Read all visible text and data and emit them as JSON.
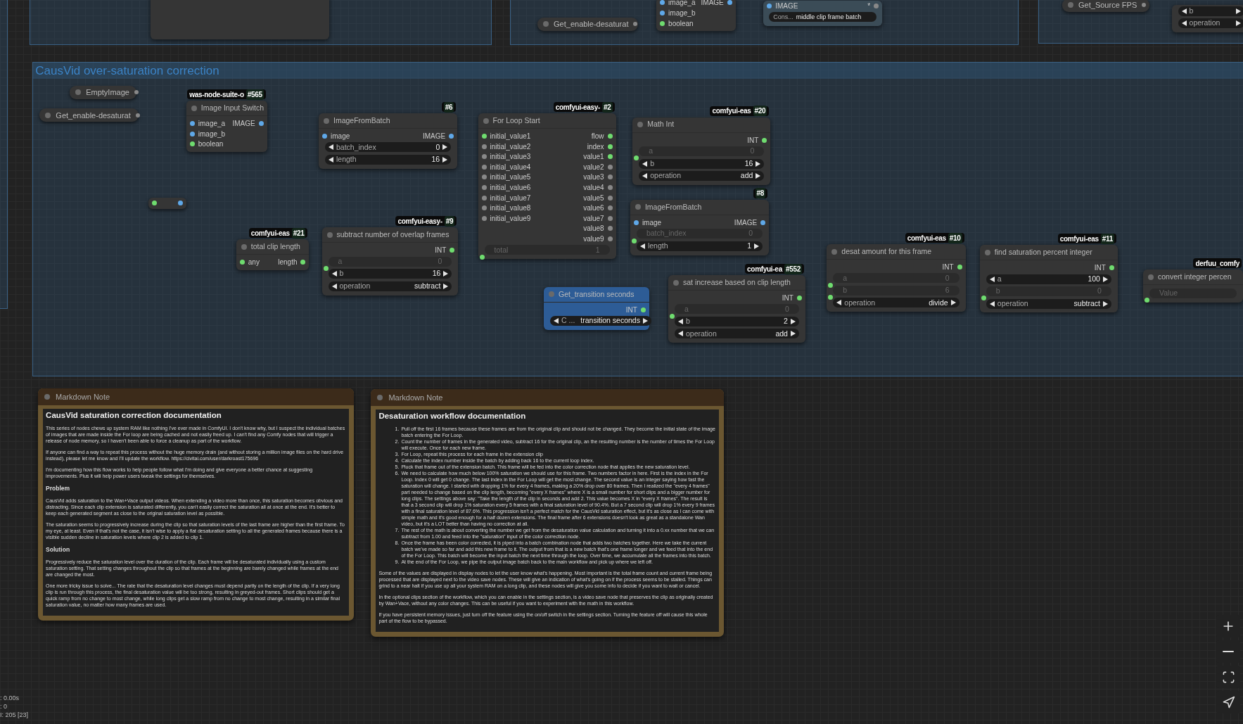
{
  "groups": [
    {
      "kind": "group"
    },
    {
      "kind": "group",
      "nodes": [
        {
          "kind": "node"
        }
      ]
    },
    {
      "kind": "group",
      "nodes": [
        {
          "kind": "pill",
          "title": "Get_enable-desaturat"
        },
        {
          "kind": "node",
          "inputs": [
            {
              "label": "image_a",
              "color": "#5fa8e8"
            },
            {
              "label": "image_b",
              "color": "#5fa8e8"
            },
            {
              "label": "boolean",
              "color": "#6fdc6f"
            }
          ],
          "outputs": [
            {
              "label": "IMAGE",
              "color": "#5fa8e8"
            }
          ]
        },
        {
          "kind": "node",
          "color": "#3b4c57",
          "inputs": [
            {
              "label": "IMAGE",
              "color": "#5fa8e8"
            }
          ],
          "outputs": [
            {
              "label": "*",
              "color": "#888888"
            }
          ],
          "widgets": [
            {
              "kind": "text",
              "label": "Cons...",
              "value": "middle clip frame batch",
              "linked": false
            }
          ]
        }
      ]
    },
    {
      "kind": "group",
      "nodes": [
        {
          "kind": "pill",
          "title": "Get_Source FPS"
        },
        {
          "kind": "node",
          "widgets": [
            {
              "label": "b",
              "linked": false
            },
            {
              "label": "operation",
              "linked": false
            }
          ]
        }
      ]
    },
    {
      "kind": "group",
      "title": "CausVid over-saturation correction",
      "nodes": [
        {
          "kind": "pill",
          "title": "EmptyImage"
        },
        {
          "kind": "pill",
          "title": "Get_enable-desaturat"
        },
        {
          "kind": "node",
          "badge": {
            "source": "was-node-suite-o",
            "id": "#565"
          },
          "title": "Image Input Switch",
          "inputs": [
            {
              "label": "image_a",
              "color": "#5fa8e8"
            },
            {
              "label": "image_b",
              "color": "#5fa8e8"
            },
            {
              "label": "boolean",
              "color": "#6fdc6f"
            }
          ],
          "outputs": [
            {
              "label": "IMAGE",
              "color": "#5fa8e8"
            }
          ]
        },
        {
          "kind": "reroute",
          "inputs": [
            {
              "color": "#6fdc6f"
            }
          ],
          "outputs": [
            {
              "color": "#5fa8e8"
            }
          ]
        },
        {
          "kind": "node",
          "badge": {
            "id": "#6"
          },
          "title": "ImageFromBatch",
          "inputs": [
            {
              "label": "image",
              "color": "#5fa8e8"
            }
          ],
          "outputs": [
            {
              "label": "IMAGE",
              "color": "#5fa8e8"
            }
          ],
          "widgets": [
            {
              "label": "batch_index",
              "value": "0",
              "linked": false
            },
            {
              "label": "length",
              "value": "16",
              "linked": false
            }
          ]
        },
        {
          "kind": "node",
          "badge": {
            "source": "comfyui-easy-",
            "id": "#2"
          },
          "title": "For Loop Start",
          "inputs": [
            {
              "label": "initial_value1",
              "color": "#6fdc6f"
            },
            {
              "label": "initial_value2",
              "color": "#888888"
            },
            {
              "label": "initial_value3",
              "color": "#888888"
            },
            {
              "label": "initial_value4",
              "color": "#888888"
            },
            {
              "label": "initial_value5",
              "color": "#888888"
            },
            {
              "label": "initial_value6",
              "color": "#888888"
            },
            {
              "label": "initial_value7",
              "color": "#888888"
            },
            {
              "label": "initial_value8",
              "color": "#888888"
            },
            {
              "label": "initial_value9",
              "color": "#888888"
            }
          ],
          "outputs": [
            {
              "label": "flow",
              "color": "#6fdc6f"
            },
            {
              "label": "index",
              "color": "#6fdc6f"
            },
            {
              "label": "value1",
              "color": "#6fdc6f"
            },
            {
              "label": "value2",
              "color": "#888888"
            },
            {
              "label": "value3",
              "color": "#888888"
            },
            {
              "label": "value4",
              "color": "#888888"
            },
            {
              "label": "value5",
              "color": "#888888"
            },
            {
              "label": "value6",
              "color": "#888888"
            },
            {
              "label": "value7",
              "color": "#888888"
            },
            {
              "label": "value8",
              "color": "#888888"
            },
            {
              "label": "value9",
              "color": "#888888"
            }
          ],
          "widgets": [
            {
              "label": "total",
              "value": "1",
              "linked": true
            }
          ]
        },
        {
          "kind": "node",
          "badge": {
            "source": "comfyui-eas",
            "id": "#20"
          },
          "title": "Math Int",
          "outputs": [
            {
              "label": "INT",
              "color": "#6fdc6f"
            }
          ],
          "widgets": [
            {
              "label": "a",
              "value": "0",
              "linked": true
            },
            {
              "label": "b",
              "value": "16",
              "linked": false
            },
            {
              "label": "operation",
              "value": "add",
              "linked": false
            }
          ]
        },
        {
          "kind": "node",
          "badge": {
            "id": "#8"
          },
          "title": "ImageFromBatch",
          "inputs": [
            {
              "label": "image",
              "color": "#5fa8e8"
            }
          ],
          "outputs": [
            {
              "label": "IMAGE",
              "color": "#5fa8e8"
            }
          ],
          "widgets": [
            {
              "label": "batch_index",
              "value": "0",
              "linked": true
            },
            {
              "label": "length",
              "value": "1",
              "linked": false
            }
          ]
        },
        {
          "kind": "node",
          "badge": {
            "source": "comfyui-eas",
            "id": "#21"
          },
          "title": "total clip length",
          "inputs": [
            {
              "label": "any",
              "color": "#6fdc6f"
            }
          ],
          "outputs": [
            {
              "label": "length",
              "color": "#6fdc6f"
            }
          ]
        },
        {
          "kind": "node",
          "badge": {
            "source": "comfyui-easy-",
            "id": "#9"
          },
          "title": "subtract number of overlap frames",
          "outputs": [
            {
              "label": "INT",
              "color": "#6fdc6f"
            }
          ],
          "widgets": [
            {
              "label": "a",
              "value": "0",
              "linked": true
            },
            {
              "label": "b",
              "value": "16",
              "linked": false
            },
            {
              "label": "operation",
              "value": "subtract",
              "linked": false
            }
          ]
        },
        {
          "kind": "node",
          "color": "#2d5c96",
          "title": "Get_transition seconds",
          "outputs": [
            {
              "label": "INT",
              "color": "#6fdc6f"
            }
          ],
          "widgets": [
            {
              "label": "C ...",
              "value": "transition seconds",
              "linked": false
            }
          ]
        },
        {
          "kind": "node",
          "badge": {
            "source": "comfyui-ea",
            "id": "#552"
          },
          "title": "sat increase based on clip length",
          "outputs": [
            {
              "label": "INT",
              "color": "#6fdc6f"
            }
          ],
          "widgets": [
            {
              "label": "a",
              "value": "0",
              "linked": true
            },
            {
              "label": "b",
              "value": "2",
              "linked": false
            },
            {
              "label": "operation",
              "value": "add",
              "linked": false
            }
          ]
        },
        {
          "kind": "node",
          "badge": {
            "source": "comfyui-eas",
            "id": "#10"
          },
          "title": "desat amount for this frame",
          "outputs": [
            {
              "label": "INT",
              "color": "#6fdc6f"
            }
          ],
          "widgets": [
            {
              "label": "a",
              "value": "0",
              "linked": true
            },
            {
              "label": "b",
              "value": "6",
              "linked": true
            },
            {
              "label": "operation",
              "value": "divide",
              "linked": false
            }
          ]
        },
        {
          "kind": "node",
          "badge": {
            "source": "comfyui-eas",
            "id": "#11"
          },
          "title": "find saturation percent integer",
          "outputs": [
            {
              "label": "INT",
              "color": "#6fdc6f"
            }
          ],
          "widgets": [
            {
              "label": "a",
              "value": "100",
              "linked": false
            },
            {
              "label": "b",
              "value": "0",
              "linked": true
            },
            {
              "label": "operation",
              "value": "subtract",
              "linked": false
            }
          ]
        },
        {
          "kind": "node",
          "badge": {
            "source": "derfuu_comfy"
          },
          "title": "convert integer percen",
          "widgets": [
            {
              "label": "Value",
              "linked": true
            }
          ]
        }
      ]
    }
  ],
  "notes": [
    {
      "header": "Markdown Note",
      "title": "CausVid saturation correction documentation",
      "blocks": [
        {
          "kind": "paragraph",
          "text": "This series of nodes chews up system RAM like nothing I've ever made in ComfyUI. I don't know why, but I suspect the individual batches of images that are made inside the For loop are being cached and not easily freed up. I can't find any Comfy nodes that will trigger a release of node memory, so I haven't been able to force a cleanup as part of the workflow."
        },
        {
          "kind": "paragraph",
          "text": "If anyone can find a way to repeat this process without the huge memory drain (and without storing a million image files on the hard drive instead), please let me know and I'll update the workflow.",
          "link": "https://civitai.com/user/darkroast175696"
        },
        {
          "kind": "paragraph",
          "text": "I'm documenting how this flow works to help people follow what I'm doing and give everyone a better chance at suggesting improvements. Plus it will help power users tweak the settings for themselves."
        },
        {
          "kind": "heading",
          "text": "Problem"
        },
        {
          "kind": "paragraph",
          "text": "CausVid adds saturation to the Wan+Vace output videos. When extending a video more than once, this saturation becomes obvious and distracting. Since each clip extension is saturated differently, you can't easily correct the saturation all at once at the end. It's better to keep each generated segment as close to the original saturation level as possible."
        },
        {
          "kind": "paragraph",
          "text": "The saturation seems to progressively increase during the clip so that saturation levels of the last frame are higher than the first frame. To my eye, at least. Even if that's not the case, it isn't wise to apply a flat desaturation setting to all the generated frames because there is a visible sudden decline in saturation levels where clip 2 is added to clip 1."
        },
        {
          "kind": "heading",
          "text": "Solution"
        },
        {
          "kind": "paragraph",
          "text": "Progressively reduce the saturation level over the duration of the clip. Each frame will be desaturated individually using a custom saturation setting. That setting changes throughout the clip so that frames at the beginning are barely changed while frames at the end are changed the most."
        },
        {
          "kind": "paragraph",
          "text": "One more tricky issue to solve... The rate that the desaturation level changes must depend partly on the length of the clip. If a very long clip is run through this process, the final desaturation value will be too strong, resulting in greyed-out frames. Short clips should get a quick ramp from no change to most change, while long clips get a slow ramp from no change to most change, resulting in a similar final saturation value, no matter how many frames are used."
        }
      ]
    },
    {
      "header": "Markdown Note",
      "title": "Desaturation workflow documentation",
      "blocks": [
        {
          "kind": "list",
          "items": [
            {
              "number": "1.",
              "text": "Pull off the first 16 frames because these frames are from the original clip and should not be changed. They become the initial state of the image batch entering the For Loop."
            },
            {
              "number": "2.",
              "text": "Count the number of frames in the generated video, subtract 16 for the original clip, an the resulting number is the number of times the For Loop will execute. Once for each new frame."
            },
            {
              "number": "3.",
              "text": "For Loop, repeat this process for each frame in the extension clip"
            },
            {
              "number": "4.",
              "text": "Calculate the index number inside the batch by adding back 16 to the current loop index."
            },
            {
              "number": "5.",
              "text": "Pluck that frame out of the extension batch. This frame will be fed into the color correction node that applies the new saturation level."
            },
            {
              "number": "6.",
              "text": "We need to calculate how much below 100% saturation we should use for this frame. Two numbers factor in here. First is the index in the For Loop. Index 0 will get 0 change. The last index in the For Loop will get the most change. The second value is an integer saying how fast the saturation will change. I started with dropping 1% for every 4 frames, making a 20% drop over 80 frames. Then I realized the \"every 4 frames\" part needed to change based on the clip length, becoming \"every X frames\" where X is a small number for short clips and a bigger number for long clips. The settings above say: \"Take the length of the clip in seconds and add 2. This value becomes X in \"every X frames\". The result is that a 3 second clip will drop 1% saturation every 5 frames with a final saturation level of 90.4%. But a 7 second clip will drop 1% every 9 frames with a final saturation level of 87.6%. This progression isn't a perfect match for the CausVid saturation effect, but it's as close as I can come with simple math and it's good enough for a half dozen extensions. The final frame after 6 extensions doesn't look as great as a standalone Wan video, but it's a LOT better than having no correction at all."
            },
            {
              "number": "7.",
              "text": "The rest of the math is about converting the number we get from the desaturation value calculation and turning it into a 0.xx number that we can subtract from 1.00 and feed into the \"saturation\" input of the color correction node."
            },
            {
              "number": "8.",
              "text": "Once the frame has been color corrected, it is piped into a batch combination node that adds two batches together. Here we take the current batch we've made so far and add this new frame to it. The output from that is a new batch that's one frame longer and we feed that into the end of the For Loop. This batch will become the input batch the next time through the loop. Over time, we accumulate all the frames into this batch."
            },
            {
              "number": "9.",
              "text": "At the end of the For Loop, we pipe the output image batch back to the main workflow and pick up where we left off."
            }
          ]
        },
        {
          "kind": "paragraph",
          "text": "Some of the values are displayed in display nodes to let the user know what's happening. Most important is the total frame count and current frame being processed that are displayed next to the video save nodes. These will give an indication of what's going on if the process seems to be stalled. Things can grind to a near halt if you use up all your system RAM on a long clip, and these nodes will give you some info to decide if you want to wait or cancel."
        },
        {
          "kind": "paragraph",
          "text": "In the optional clips section of the workflow, which you can enable in the settings section, is a video save node that preserves the clip as originally created by Wan+Vace, without any color changes. This can be useful if you want to experiment with the math in this workflow."
        },
        {
          "kind": "paragraph",
          "text": "If you have persistent memory issues, just turn off the feature using the on/off switch in the settings section. Turning the feature off will cause this whole part of the flow to be bypassed."
        }
      ]
    }
  ],
  "stats": [
    ": 0.00s",
    ": 0",
    "I: 205 [23]"
  ]
}
